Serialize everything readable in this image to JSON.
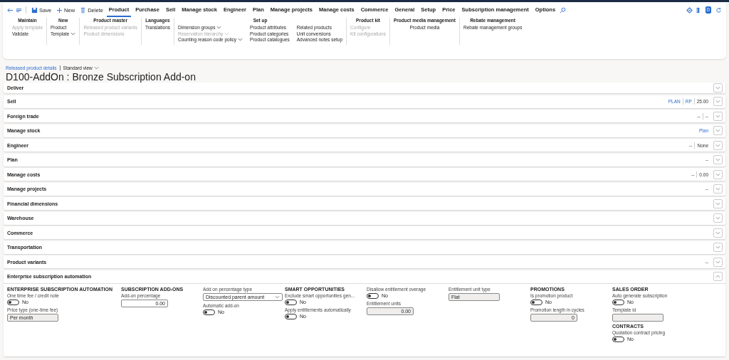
{
  "toolbar": {
    "actions": [
      {
        "label": "Save"
      },
      {
        "label": "New"
      },
      {
        "label": "Delete"
      }
    ],
    "tabs": [
      {
        "label": "Product",
        "selected": true
      },
      {
        "label": "Purchase",
        "selected": false
      },
      {
        "label": "Sell",
        "selected": false
      },
      {
        "label": "Manage stock",
        "selected": false
      },
      {
        "label": "Engineer",
        "selected": false
      },
      {
        "label": "Plan",
        "selected": false
      },
      {
        "label": "Manage projects",
        "selected": false
      },
      {
        "label": "Manage costs",
        "selected": false
      },
      {
        "label": "Commerce",
        "selected": false
      },
      {
        "label": "General",
        "selected": false
      },
      {
        "label": "Setup",
        "selected": false
      },
      {
        "label": "Price",
        "selected": false
      },
      {
        "label": "Subscription management",
        "selected": false
      },
      {
        "label": "Options",
        "selected": false
      }
    ],
    "notification_badge": "0"
  },
  "ribbon": [
    {
      "title": "Maintain",
      "columns": [
        [
          {
            "label": "Apply template",
            "disabled": true,
            "dropdown": false
          },
          {
            "label": "Validate",
            "disabled": false,
            "dropdown": false
          }
        ]
      ]
    },
    {
      "title": "New",
      "columns": [
        [
          {
            "label": "Product",
            "disabled": false,
            "dropdown": false
          },
          {
            "label": "Template",
            "disabled": false,
            "dropdown": true
          }
        ]
      ]
    },
    {
      "title": "Product master",
      "columns": [
        [
          {
            "label": "Released product variants",
            "disabled": true,
            "dropdown": false
          },
          {
            "label": "Product dimensions",
            "disabled": true,
            "dropdown": false
          }
        ]
      ]
    },
    {
      "title": "Languages",
      "columns": [
        [
          {
            "label": "Translations",
            "disabled": false,
            "dropdown": false
          }
        ]
      ]
    },
    {
      "title": "Set up",
      "columns": [
        [
          {
            "label": "Dimension groups",
            "disabled": false,
            "dropdown": true
          },
          {
            "label": "Reservation hierarchy",
            "disabled": true,
            "dropdown": true
          },
          {
            "label": "Counting reason code policy",
            "disabled": false,
            "dropdown": true
          }
        ],
        [
          {
            "label": "Product attributes",
            "disabled": false,
            "dropdown": false
          },
          {
            "label": "Product categories",
            "disabled": false,
            "dropdown": false
          },
          {
            "label": "Product catalogues",
            "disabled": false,
            "dropdown": false
          }
        ],
        [
          {
            "label": "Related products",
            "disabled": false,
            "dropdown": false
          },
          {
            "label": "Unit conversions",
            "disabled": false,
            "dropdown": false
          },
          {
            "label": "Advanced notes setup",
            "disabled": false,
            "dropdown": false
          }
        ]
      ]
    },
    {
      "title": "Product kit",
      "columns": [
        [
          {
            "label": "Configure",
            "disabled": true,
            "dropdown": false
          },
          {
            "label": "Kit configurations",
            "disabled": true,
            "dropdown": false
          }
        ]
      ]
    },
    {
      "title": "Product media management",
      "columns": [
        [
          {
            "label": "Product media",
            "disabled": false,
            "dropdown": false
          }
        ]
      ]
    },
    {
      "title": "Rebate management",
      "columns": [
        [
          {
            "label": "Rebate management groups",
            "disabled": false,
            "dropdown": false
          }
        ]
      ]
    }
  ],
  "breadcrumb": {
    "link": "Released product details",
    "view": "Standard view"
  },
  "title": "D100-AddOn : Bronze Subscription Add-on",
  "fasttabs": [
    {
      "label": "Deliver"
    },
    {
      "label": "Sell",
      "summary": [
        {
          "text": "PLAN",
          "link": true
        },
        {
          "text": "RP",
          "link": true
        },
        {
          "text": "25.00",
          "link": false
        }
      ]
    },
    {
      "label": "Foreign trade",
      "summary": [
        {
          "text": "--",
          "link": false
        },
        {
          "text": "--",
          "link": false
        }
      ]
    },
    {
      "label": "Manage stock",
      "summary": [
        {
          "text": "Plan",
          "link": true
        }
      ]
    },
    {
      "label": "Engineer",
      "summary": [
        {
          "text": "--",
          "link": false
        },
        {
          "text": "None",
          "link": false
        }
      ]
    },
    {
      "label": "Plan",
      "summary": [
        {
          "text": "--",
          "link": false
        }
      ]
    },
    {
      "label": "Manage costs",
      "summary": [
        {
          "text": "--",
          "link": false
        },
        {
          "text": "0.00",
          "link": false
        }
      ]
    },
    {
      "label": "Manage projects",
      "summary": [
        {
          "text": "--",
          "link": false
        }
      ]
    },
    {
      "label": "Financial dimensions"
    },
    {
      "label": "Warehouse"
    },
    {
      "label": "Commerce"
    },
    {
      "label": "Transportation"
    },
    {
      "label": "Product variants",
      "summary": [
        {
          "text": "--",
          "link": false
        }
      ]
    }
  ],
  "expanded_tab": {
    "label": "Enterprise subscription automation",
    "expanded": true,
    "columns": [
      [
        {
          "kind": "heading",
          "label": "ENTERPRISE SUBSCRIPTION AUTOMATION"
        },
        {
          "kind": "toggle",
          "label": "One time fee / credit note",
          "on": false,
          "value": "No"
        },
        {
          "kind": "text",
          "label": "Price type (one-time fee)",
          "value": "Per month",
          "editable": false
        }
      ],
      [
        {
          "kind": "heading",
          "label": "SUBSCRIPTION ADD-ONS"
        },
        {
          "kind": "number",
          "label": "Add-on percentage",
          "value": "0.00",
          "editable": true
        }
      ],
      [
        {
          "kind": "select",
          "label": "Add on percentage type",
          "value": "Discounted parent amount"
        },
        {
          "kind": "toggle",
          "label": "Automatic add-on",
          "on": false,
          "value": "No"
        }
      ],
      [
        {
          "kind": "heading",
          "label": "SMART OPPORTUNITIES"
        },
        {
          "kind": "toggle",
          "label": "Exclude smart opportunities gen...",
          "on": false,
          "value": "No"
        },
        {
          "kind": "toggle",
          "label": "Apply entitlements automatically",
          "on": false,
          "value": "No"
        }
      ],
      [
        {
          "kind": "toggle",
          "label": "Disallow entitlement overage",
          "on": false,
          "value": "No"
        },
        {
          "kind": "number",
          "label": "Entitlement units",
          "value": "0.00",
          "editable": false
        }
      ],
      [
        {
          "kind": "text",
          "label": "Entitlement unit type",
          "value": "Flat",
          "editable": false
        }
      ],
      [
        {
          "kind": "heading",
          "label": "PROMOTIONS"
        },
        {
          "kind": "toggle",
          "label": "Is promotion product",
          "on": false,
          "value": "No"
        },
        {
          "kind": "number",
          "label": "Promotion length in cycles",
          "value": "0",
          "editable": false
        }
      ],
      [
        {
          "kind": "heading",
          "label": "SALES ORDER"
        },
        {
          "kind": "toggle",
          "label": "Auto generate subscription",
          "on": false,
          "value": "No"
        },
        {
          "kind": "text",
          "label": "Template id",
          "editable": false
        },
        {
          "kind": "heading",
          "label": "CONTRACTS"
        },
        {
          "kind": "toggle",
          "label": "Quotation contract pricing",
          "on": false,
          "value": "No"
        }
      ]
    ]
  }
}
